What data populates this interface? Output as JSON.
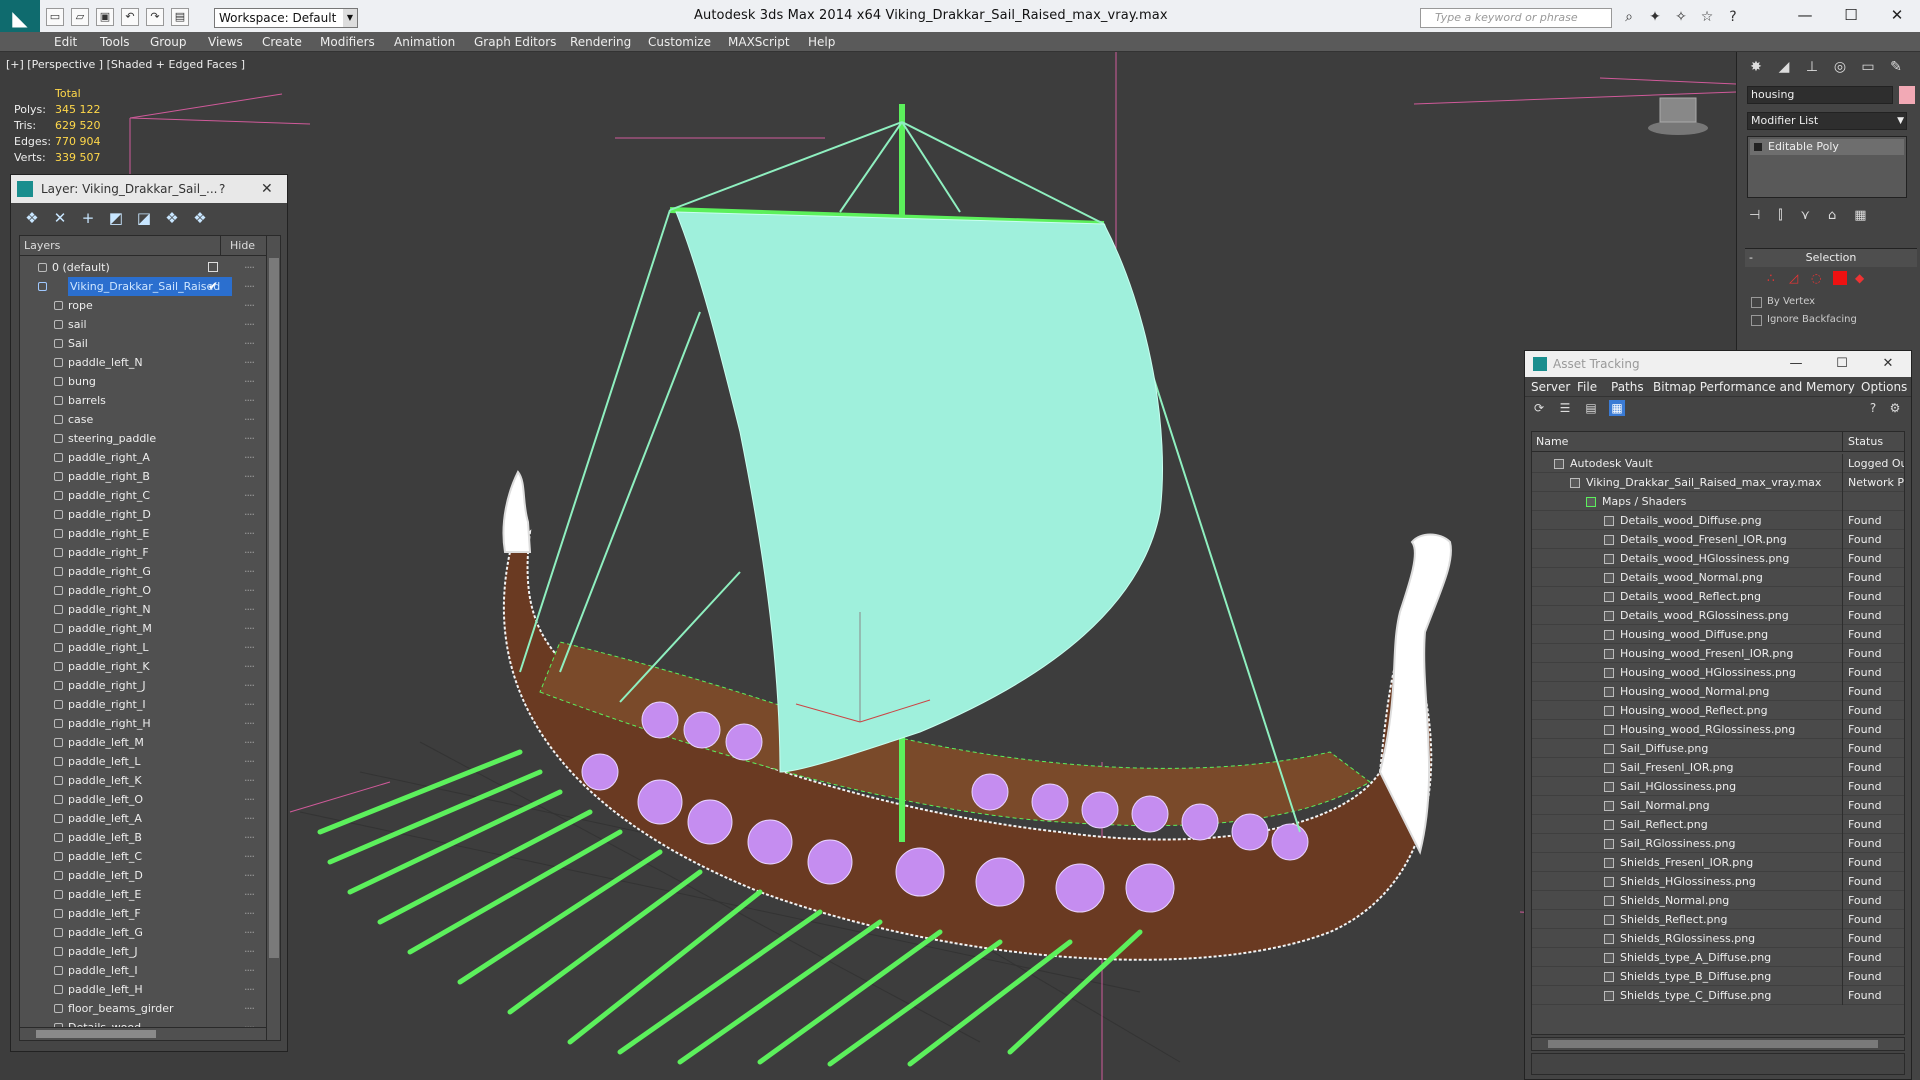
{
  "app": {
    "title": "Autodesk 3ds Max  2014 x64      Viking_Drakkar_Sail_Raised_max_vray.max",
    "workspace": "Workspace: Default",
    "search_placeholder": "Type a keyword or phrase",
    "icons": [
      "app-logo-icon",
      "new-icon",
      "open-icon",
      "save-icon",
      "undo-icon",
      "redo-icon",
      "project-icon"
    ]
  },
  "menu": [
    "Edit",
    "Tools",
    "Group",
    "Views",
    "Create",
    "Modifiers",
    "Animation",
    "Graph Editors",
    "Rendering",
    "Customize",
    "MAXScript",
    "Help"
  ],
  "viewport": {
    "label": "[+] [Perspective ] [Shaded + Edged Faces ]",
    "stats_header": "Total",
    "stats": [
      {
        "k": "Polys:",
        "v": "345 122"
      },
      {
        "k": "Tris:",
        "v": "629 520"
      },
      {
        "k": "Edges:",
        "v": "770 904"
      },
      {
        "k": "Verts:",
        "v": "339 507"
      }
    ]
  },
  "layer_window": {
    "title": "Layer: Viking_Drakkar_Sail_...",
    "help": "?",
    "col_layers": "Layers",
    "col_hide": "Hide",
    "root": "0 (default)",
    "selected": "Viking_Drakkar_Sail_Raised",
    "items": [
      "rope",
      "sail",
      "Sail",
      "paddle_left_N",
      "bung",
      "barrels",
      "case",
      "steering_paddle",
      "paddle_right_A",
      "paddle_right_B",
      "paddle_right_C",
      "paddle_right_D",
      "paddle_right_E",
      "paddle_right_F",
      "paddle_right_G",
      "paddle_right_O",
      "paddle_right_N",
      "paddle_right_M",
      "paddle_right_L",
      "paddle_right_K",
      "paddle_right_J",
      "paddle_right_I",
      "paddle_right_H",
      "paddle_left_M",
      "paddle_left_L",
      "paddle_left_K",
      "paddle_left_O",
      "paddle_left_A",
      "paddle_left_B",
      "paddle_left_C",
      "paddle_left_D",
      "paddle_left_E",
      "paddle_left_F",
      "paddle_left_G",
      "paddle_left_J",
      "paddle_left_I",
      "paddle_left_H",
      "floor_beams_girder",
      "Details_wood"
    ]
  },
  "command_panel": {
    "object_name": "housing",
    "modifier_list": "Modifier List",
    "stack_entry": "Editable Poly",
    "selection_title": "Selection",
    "options": [
      "By Vertex",
      "Ignore Backfacing"
    ],
    "object_color": "#f2a9b5"
  },
  "asset_tracking": {
    "title": "Asset Tracking",
    "menu": [
      "Server",
      "File",
      "Paths",
      "Bitmap Performance and Memory",
      "Options"
    ],
    "col_name": "Name",
    "col_status": "Status",
    "vault": {
      "name": "Autodesk Vault",
      "status": "Logged Out"
    },
    "file": {
      "name": "Viking_Drakkar_Sail_Raised_max_vray.max",
      "status": "Network Pat"
    },
    "group": "Maps / Shaders",
    "maps": [
      {
        "name": "Details_wood_Diffuse.png",
        "status": "Found"
      },
      {
        "name": "Details_wood_Fresenl_IOR.png",
        "status": "Found"
      },
      {
        "name": "Details_wood_HGlossiness.png",
        "status": "Found"
      },
      {
        "name": "Details_wood_Normal.png",
        "status": "Found"
      },
      {
        "name": "Details_wood_Reflect.png",
        "status": "Found"
      },
      {
        "name": "Details_wood_RGlossiness.png",
        "status": "Found"
      },
      {
        "name": "Housing_wood_Diffuse.png",
        "status": "Found"
      },
      {
        "name": "Housing_wood_Fresenl_IOR.png",
        "status": "Found"
      },
      {
        "name": "Housing_wood_HGlossiness.png",
        "status": "Found"
      },
      {
        "name": "Housing_wood_Normal.png",
        "status": "Found"
      },
      {
        "name": "Housing_wood_Reflect.png",
        "status": "Found"
      },
      {
        "name": "Housing_wood_RGlossiness.png",
        "status": "Found"
      },
      {
        "name": "Sail_Diffuse.png",
        "status": "Found"
      },
      {
        "name": "Sail_Fresenl_IOR.png",
        "status": "Found"
      },
      {
        "name": "Sail_HGlossiness.png",
        "status": "Found"
      },
      {
        "name": "Sail_Normal.png",
        "status": "Found"
      },
      {
        "name": "Sail_Reflect.png",
        "status": "Found"
      },
      {
        "name": "Sail_RGlossiness.png",
        "status": "Found"
      },
      {
        "name": "Shields_Fresenl_IOR.png",
        "status": "Found"
      },
      {
        "name": "Shields_HGlossiness.png",
        "status": "Found"
      },
      {
        "name": "Shields_Normal.png",
        "status": "Found"
      },
      {
        "name": "Shields_Reflect.png",
        "status": "Found"
      },
      {
        "name": "Shields_RGlossiness.png",
        "status": "Found"
      },
      {
        "name": "Shields_type_A_Diffuse.png",
        "status": "Found"
      },
      {
        "name": "Shields_type_B_Diffuse.png",
        "status": "Found"
      },
      {
        "name": "Shields_type_C_Diffuse.png",
        "status": "Found"
      }
    ]
  },
  "colors": {
    "accent": "#2b6fcf",
    "wire_green": "#5cf05c",
    "sail_cyan": "#9ff0dc",
    "hull_brown": "#6a3a22",
    "shield_violet": "#c58df0"
  }
}
